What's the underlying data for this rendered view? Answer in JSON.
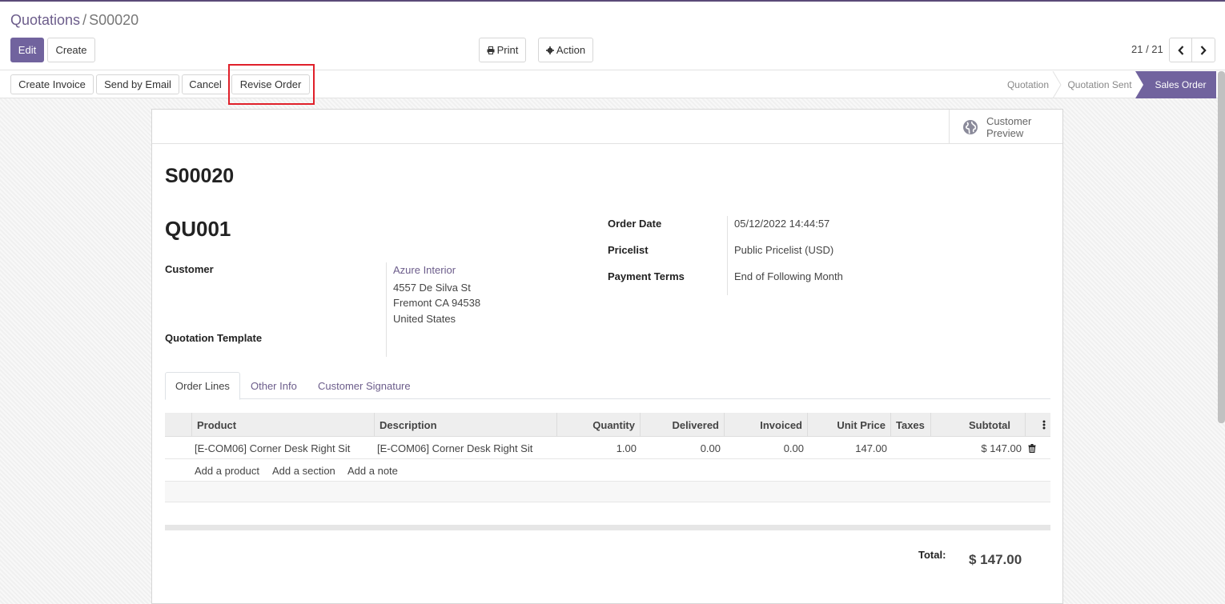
{
  "breadcrumb": {
    "parent": "Quotations",
    "separator": "/",
    "current": "S00020"
  },
  "toolbar": {
    "edit": "Edit",
    "create": "Create",
    "print": "Print",
    "action": "Action"
  },
  "pager": {
    "text": "21 / 21"
  },
  "status_buttons": {
    "create_invoice": "Create Invoice",
    "send_email": "Send by Email",
    "cancel": "Cancel",
    "revise": "Revise Order"
  },
  "stages": {
    "quotation": "Quotation",
    "sent": "Quotation Sent",
    "sales_order": "Sales Order"
  },
  "preview": {
    "label_line1": "Customer",
    "label_line2": "Preview"
  },
  "record": {
    "name": "S00020",
    "reference": "QU001",
    "customer_label": "Customer",
    "customer_name": "Azure Interior",
    "address_line1": "4557 De Silva St",
    "address_line2": "Fremont CA 94538",
    "address_line3": "United States",
    "template_label": "Quotation Template",
    "order_date_label": "Order Date",
    "order_date": "05/12/2022 14:44:57",
    "pricelist_label": "Pricelist",
    "pricelist": "Public Pricelist (USD)",
    "payment_terms_label": "Payment Terms",
    "payment_terms": "End of Following Month"
  },
  "tabs": {
    "order_lines": "Order Lines",
    "other_info": "Other Info",
    "signature": "Customer Signature"
  },
  "table": {
    "headers": {
      "product": "Product",
      "description": "Description",
      "quantity": "Quantity",
      "delivered": "Delivered",
      "invoiced": "Invoiced",
      "unit_price": "Unit Price",
      "taxes": "Taxes",
      "subtotal": "Subtotal"
    },
    "row": {
      "product": "[E-COM06] Corner Desk Right Sit",
      "description": "[E-COM06] Corner Desk Right Sit",
      "quantity": "1.00",
      "delivered": "0.00",
      "invoiced": "0.00",
      "unit_price": "147.00",
      "taxes": "",
      "subtotal": "$ 147.00"
    },
    "actions": {
      "add_product": "Add a product",
      "add_section": "Add a section",
      "add_note": "Add a note"
    }
  },
  "totals": {
    "label": "Total:",
    "value": "$ 147.00"
  },
  "colors": {
    "accent": "#71639e",
    "highlight": "#e0202a"
  }
}
